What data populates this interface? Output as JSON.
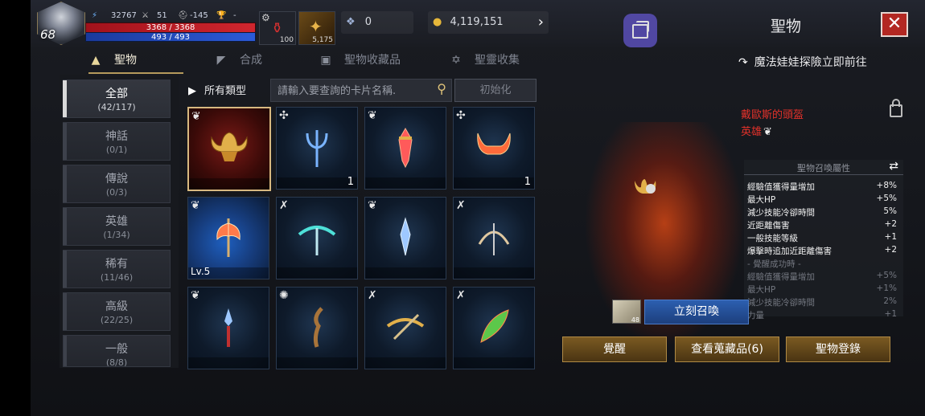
{
  "player": {
    "level": "68",
    "power": "32767",
    "attack": "51",
    "defense": "-145",
    "trophy": "-",
    "hp": "3368 / 3368",
    "mp": "493 / 493"
  },
  "items": [
    {
      "count": "100"
    },
    {
      "count": "5,175"
    }
  ],
  "currency": {
    "gems": "0",
    "gold": "4,119,151"
  },
  "header": {
    "title": "聖物",
    "close_label": "✕"
  },
  "tabs": [
    {
      "label": "聖物",
      "icon": "hat-icon"
    },
    {
      "label": "合成",
      "icon": "anvil-icon"
    },
    {
      "label": "聖物收藏品",
      "icon": "book-icon"
    },
    {
      "label": "聖靈收集",
      "icon": "star-icon"
    }
  ],
  "adventure_link": "魔法娃娃探險立即前往",
  "categories": [
    {
      "label": "全部",
      "count": "(42/117)"
    },
    {
      "label": "神話",
      "count": "(0/1)"
    },
    {
      "label": "傳說",
      "count": "(0/3)"
    },
    {
      "label": "英雄",
      "count": "(1/34)"
    },
    {
      "label": "稀有",
      "count": "(11/46)"
    },
    {
      "label": "高級",
      "count": "(22/25)"
    },
    {
      "label": "一般",
      "count": "(8/8)"
    }
  ],
  "filter": {
    "type_label": "所有類型",
    "search_placeholder": "請輸入要查詢的卡片名稱.",
    "reset_label": "初始化"
  },
  "cards": [
    {
      "qty": "",
      "lv": ""
    },
    {
      "qty": "1",
      "lv": ""
    },
    {
      "qty": "",
      "lv": ""
    },
    {
      "qty": "1",
      "lv": ""
    },
    {
      "qty": "",
      "lv": "Lv.5"
    },
    {
      "qty": "",
      "lv": ""
    },
    {
      "qty": "",
      "lv": ""
    },
    {
      "qty": "",
      "lv": ""
    },
    {
      "qty": "",
      "lv": ""
    },
    {
      "qty": "",
      "lv": ""
    },
    {
      "qty": "",
      "lv": ""
    },
    {
      "qty": "",
      "lv": ""
    }
  ],
  "detail": {
    "name": "戴歐斯的頭盔",
    "rarity": "英雄",
    "attr_header": "聖物召喚屬性",
    "attrs": [
      {
        "name": "經驗值獲得量增加",
        "value": "+8%"
      },
      {
        "name": "最大HP",
        "value": "+5%"
      },
      {
        "name": "減少技能冷卻時間",
        "value": "5%"
      },
      {
        "name": "近距離傷害",
        "value": "+2"
      },
      {
        "name": "一般技能等級",
        "value": "+1"
      },
      {
        "name": "爆擊時追加近距離傷害",
        "value": "+2"
      }
    ],
    "awaken_header": "- 覺醒成功時 -",
    "awaken_attrs": [
      {
        "name": "經驗值獲得量增加",
        "value": "+5%"
      },
      {
        "name": "最大HP",
        "value": "+1%"
      },
      {
        "name": "減少技能冷卻時間",
        "value": "2%"
      },
      {
        "name": "力量",
        "value": "+1"
      }
    ],
    "summon_item_count": "48",
    "summon_label": "立刻召喚"
  },
  "actions": {
    "awaken": "覺醒",
    "view_collection": "查看蒐藏品(6)",
    "register": "聖物登錄"
  }
}
